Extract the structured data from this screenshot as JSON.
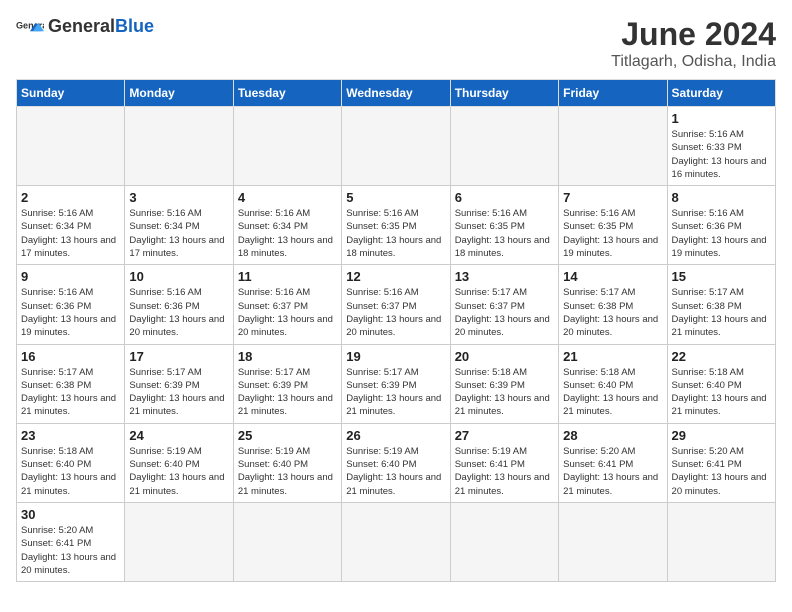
{
  "header": {
    "logo_general": "General",
    "logo_blue": "Blue",
    "month_year": "June 2024",
    "location": "Titlagarh, Odisha, India"
  },
  "days_of_week": [
    "Sunday",
    "Monday",
    "Tuesday",
    "Wednesday",
    "Thursday",
    "Friday",
    "Saturday"
  ],
  "weeks": [
    [
      {
        "day": "",
        "content": ""
      },
      {
        "day": "",
        "content": ""
      },
      {
        "day": "",
        "content": ""
      },
      {
        "day": "",
        "content": ""
      },
      {
        "day": "",
        "content": ""
      },
      {
        "day": "",
        "content": ""
      },
      {
        "day": "1",
        "content": "Sunrise: 5:16 AM\nSunset: 6:33 PM\nDaylight: 13 hours and 16 minutes."
      }
    ],
    [
      {
        "day": "2",
        "content": "Sunrise: 5:16 AM\nSunset: 6:34 PM\nDaylight: 13 hours and 17 minutes."
      },
      {
        "day": "3",
        "content": "Sunrise: 5:16 AM\nSunset: 6:34 PM\nDaylight: 13 hours and 17 minutes."
      },
      {
        "day": "4",
        "content": "Sunrise: 5:16 AM\nSunset: 6:34 PM\nDaylight: 13 hours and 18 minutes."
      },
      {
        "day": "5",
        "content": "Sunrise: 5:16 AM\nSunset: 6:35 PM\nDaylight: 13 hours and 18 minutes."
      },
      {
        "day": "6",
        "content": "Sunrise: 5:16 AM\nSunset: 6:35 PM\nDaylight: 13 hours and 18 minutes."
      },
      {
        "day": "7",
        "content": "Sunrise: 5:16 AM\nSunset: 6:35 PM\nDaylight: 13 hours and 19 minutes."
      },
      {
        "day": "8",
        "content": "Sunrise: 5:16 AM\nSunset: 6:36 PM\nDaylight: 13 hours and 19 minutes."
      }
    ],
    [
      {
        "day": "9",
        "content": "Sunrise: 5:16 AM\nSunset: 6:36 PM\nDaylight: 13 hours and 19 minutes."
      },
      {
        "day": "10",
        "content": "Sunrise: 5:16 AM\nSunset: 6:36 PM\nDaylight: 13 hours and 20 minutes."
      },
      {
        "day": "11",
        "content": "Sunrise: 5:16 AM\nSunset: 6:37 PM\nDaylight: 13 hours and 20 minutes."
      },
      {
        "day": "12",
        "content": "Sunrise: 5:16 AM\nSunset: 6:37 PM\nDaylight: 13 hours and 20 minutes."
      },
      {
        "day": "13",
        "content": "Sunrise: 5:17 AM\nSunset: 6:37 PM\nDaylight: 13 hours and 20 minutes."
      },
      {
        "day": "14",
        "content": "Sunrise: 5:17 AM\nSunset: 6:38 PM\nDaylight: 13 hours and 20 minutes."
      },
      {
        "day": "15",
        "content": "Sunrise: 5:17 AM\nSunset: 6:38 PM\nDaylight: 13 hours and 21 minutes."
      }
    ],
    [
      {
        "day": "16",
        "content": "Sunrise: 5:17 AM\nSunset: 6:38 PM\nDaylight: 13 hours and 21 minutes."
      },
      {
        "day": "17",
        "content": "Sunrise: 5:17 AM\nSunset: 6:39 PM\nDaylight: 13 hours and 21 minutes."
      },
      {
        "day": "18",
        "content": "Sunrise: 5:17 AM\nSunset: 6:39 PM\nDaylight: 13 hours and 21 minutes."
      },
      {
        "day": "19",
        "content": "Sunrise: 5:17 AM\nSunset: 6:39 PM\nDaylight: 13 hours and 21 minutes."
      },
      {
        "day": "20",
        "content": "Sunrise: 5:18 AM\nSunset: 6:39 PM\nDaylight: 13 hours and 21 minutes."
      },
      {
        "day": "21",
        "content": "Sunrise: 5:18 AM\nSunset: 6:40 PM\nDaylight: 13 hours and 21 minutes."
      },
      {
        "day": "22",
        "content": "Sunrise: 5:18 AM\nSunset: 6:40 PM\nDaylight: 13 hours and 21 minutes."
      }
    ],
    [
      {
        "day": "23",
        "content": "Sunrise: 5:18 AM\nSunset: 6:40 PM\nDaylight: 13 hours and 21 minutes."
      },
      {
        "day": "24",
        "content": "Sunrise: 5:19 AM\nSunset: 6:40 PM\nDaylight: 13 hours and 21 minutes."
      },
      {
        "day": "25",
        "content": "Sunrise: 5:19 AM\nSunset: 6:40 PM\nDaylight: 13 hours and 21 minutes."
      },
      {
        "day": "26",
        "content": "Sunrise: 5:19 AM\nSunset: 6:40 PM\nDaylight: 13 hours and 21 minutes."
      },
      {
        "day": "27",
        "content": "Sunrise: 5:19 AM\nSunset: 6:41 PM\nDaylight: 13 hours and 21 minutes."
      },
      {
        "day": "28",
        "content": "Sunrise: 5:20 AM\nSunset: 6:41 PM\nDaylight: 13 hours and 21 minutes."
      },
      {
        "day": "29",
        "content": "Sunrise: 5:20 AM\nSunset: 6:41 PM\nDaylight: 13 hours and 20 minutes."
      }
    ],
    [
      {
        "day": "30",
        "content": "Sunrise: 5:20 AM\nSunset: 6:41 PM\nDaylight: 13 hours and 20 minutes."
      },
      {
        "day": "",
        "content": ""
      },
      {
        "day": "",
        "content": ""
      },
      {
        "day": "",
        "content": ""
      },
      {
        "day": "",
        "content": ""
      },
      {
        "day": "",
        "content": ""
      },
      {
        "day": "",
        "content": ""
      }
    ]
  ]
}
